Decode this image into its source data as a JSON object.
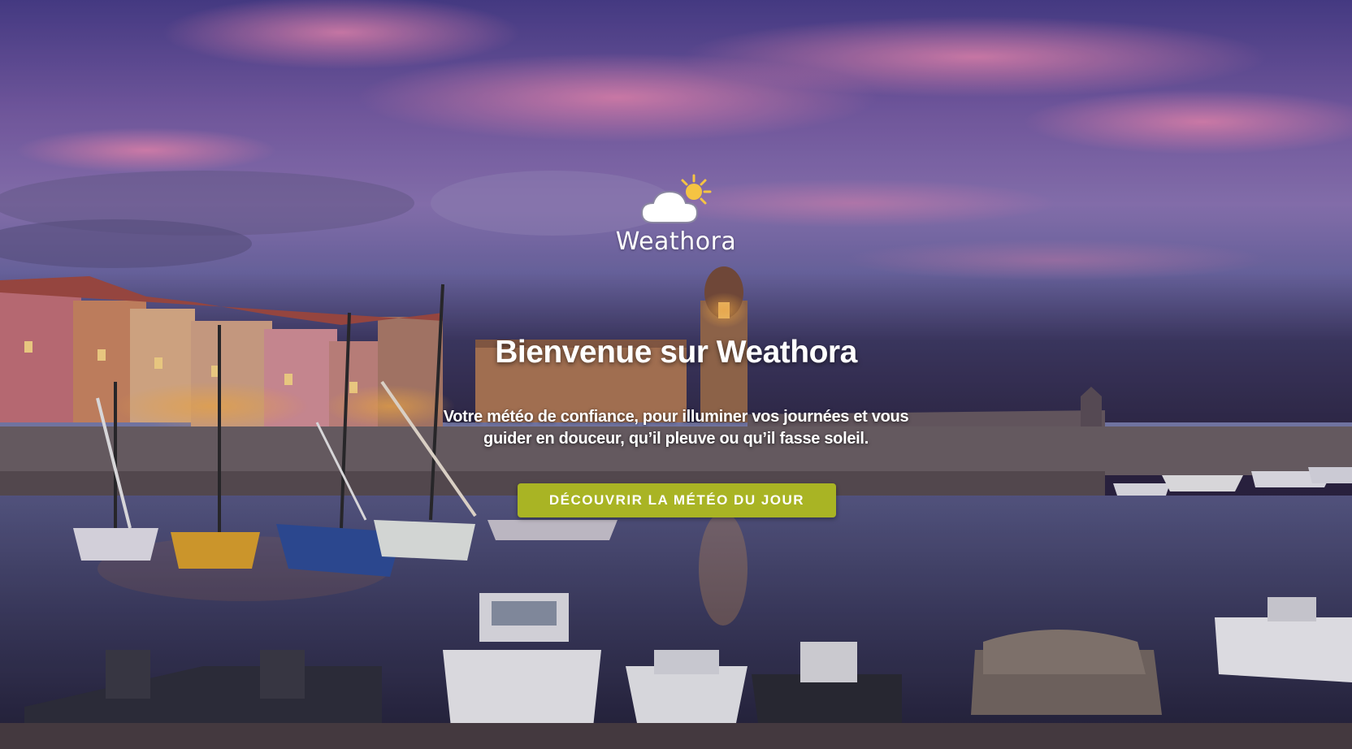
{
  "brand": {
    "name": "Weathora",
    "logo_icon": "cloud-sun-icon"
  },
  "hero": {
    "headline": "Bienvenue sur Weathora",
    "tagline_line1": "Votre météo de confiance, pour illuminer vos journées et vous",
    "tagline_line2": "guider en douceur, qu’il pleuve ou qu’il fasse soleil.",
    "cta_label": "DÉCOUVRIR LA MÉTÉO DU JOUR",
    "background": "harbor-at-dusk-photo"
  },
  "colors": {
    "cta": "#a9b424",
    "sun": "#f6c443",
    "text": "#ffffff"
  }
}
